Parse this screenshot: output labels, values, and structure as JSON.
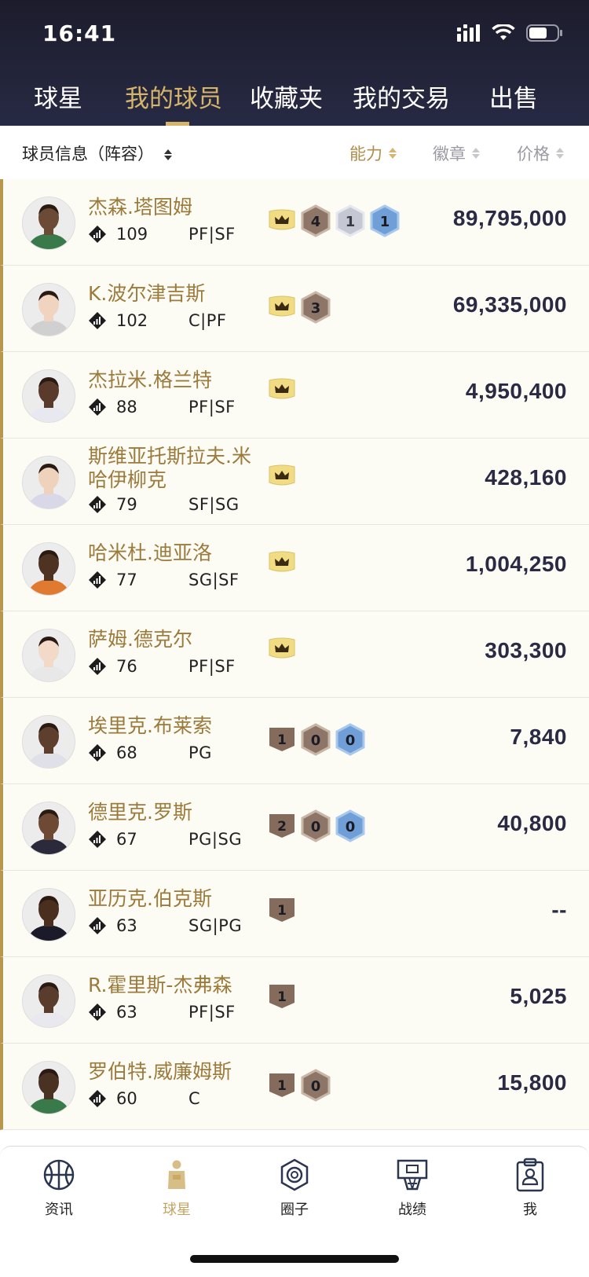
{
  "status": {
    "time": "16:41"
  },
  "tabs": [
    {
      "label": "球星",
      "active": false
    },
    {
      "label": "我的球员",
      "active": true
    },
    {
      "label": "收藏夹",
      "active": false
    },
    {
      "label": "我的交易",
      "active": false
    },
    {
      "label": "出售",
      "active": false
    }
  ],
  "filter": {
    "title": "球员信息（阵容）",
    "sort_ability": "能力",
    "sort_badge": "徽章",
    "sort_price": "价格"
  },
  "players": [
    {
      "name": "杰森.塔图姆",
      "rating": "109",
      "position": "PF|SF",
      "price": "89,795,000",
      "crown": true,
      "badges": [
        {
          "type": "bronze",
          "value": "4"
        },
        {
          "type": "silver",
          "value": "1"
        },
        {
          "type": "blue",
          "value": "1"
        }
      ]
    },
    {
      "name": "K.波尔津吉斯",
      "rating": "102",
      "position": "C|PF",
      "price": "69,335,000",
      "crown": true,
      "badges": [
        {
          "type": "bronze",
          "value": "3"
        }
      ]
    },
    {
      "name": "杰拉米.格兰特",
      "rating": "88",
      "position": "PF|SF",
      "price": "4,950,400",
      "crown": true,
      "badges": []
    },
    {
      "name": "斯维亚托斯拉夫.米哈伊柳克",
      "rating": "79",
      "position": "SF|SG",
      "price": "428,160",
      "crown": true,
      "badges": []
    },
    {
      "name": "哈米杜.迪亚洛",
      "rating": "77",
      "position": "SG|SF",
      "price": "1,004,250",
      "crown": true,
      "badges": []
    },
    {
      "name": "萨姆.德克尔",
      "rating": "76",
      "position": "PF|SF",
      "price": "303,300",
      "crown": true,
      "badges": []
    },
    {
      "name": "埃里克.布莱索",
      "rating": "68",
      "position": "PG",
      "price": "7,840",
      "crown": false,
      "badges": [
        {
          "type": "pentagon",
          "value": "1"
        },
        {
          "type": "bronze",
          "value": "0"
        },
        {
          "type": "blue",
          "value": "0"
        }
      ]
    },
    {
      "name": "德里克.罗斯",
      "rating": "67",
      "position": "PG|SG",
      "price": "40,800",
      "crown": false,
      "badges": [
        {
          "type": "pentagon",
          "value": "2"
        },
        {
          "type": "bronze",
          "value": "0"
        },
        {
          "type": "blue",
          "value": "0"
        }
      ]
    },
    {
      "name": "亚历克.伯克斯",
      "rating": "63",
      "position": "SG|PG",
      "price": "--",
      "crown": false,
      "badges": [
        {
          "type": "pentagon",
          "value": "1"
        }
      ]
    },
    {
      "name": "R.霍里斯-杰弗森",
      "rating": "63",
      "position": "PF|SF",
      "price": "5,025",
      "crown": false,
      "badges": [
        {
          "type": "pentagon",
          "value": "1"
        }
      ]
    },
    {
      "name": "罗伯特.威廉姆斯",
      "rating": "60",
      "position": "C",
      "price": "15,800",
      "crown": false,
      "badges": [
        {
          "type": "pentagon",
          "value": "1"
        },
        {
          "type": "bronze",
          "value": "0"
        }
      ]
    }
  ],
  "bottom_nav": [
    {
      "label": "资讯",
      "icon": "basketball-icon",
      "active": false
    },
    {
      "label": "球星",
      "icon": "player-jersey-icon",
      "active": true
    },
    {
      "label": "圈子",
      "icon": "circle-community-icon",
      "active": false
    },
    {
      "label": "战绩",
      "icon": "basketball-hoop-icon",
      "active": false
    },
    {
      "label": "我",
      "icon": "clipboard-profile-icon",
      "active": false
    }
  ],
  "colors": {
    "header_bg": "#232438",
    "gold_accent": "#d6b46a",
    "row_bg": "#fdfcf4",
    "name_color": "#9c7a3c",
    "price_color": "#2a2a44"
  }
}
